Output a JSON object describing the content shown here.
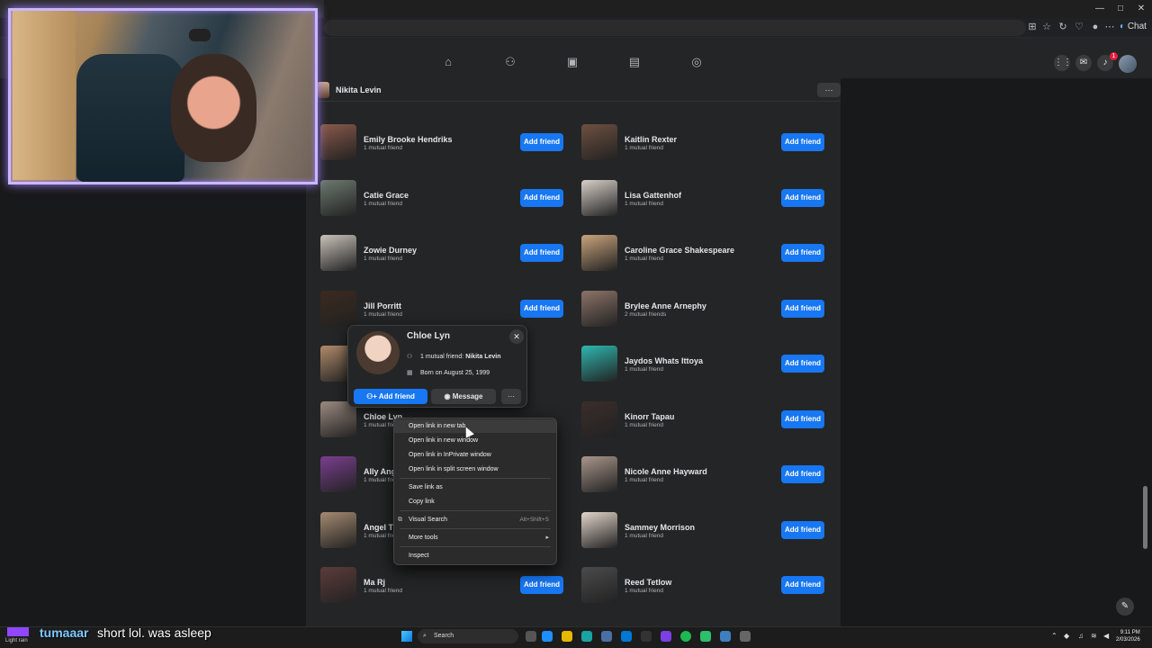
{
  "browser": {
    "copilot_label": "Chat",
    "window_controls": [
      "—",
      "□",
      "✕"
    ]
  },
  "profile": {
    "name": "Nikita Levin",
    "more_label": "···"
  },
  "friends_left": [
    {
      "name": "Emily Brooke Hendriks",
      "mutual": "1 mutual friend",
      "button": "Add friend",
      "photo": "#8a5a4a"
    },
    {
      "name": "Catie Grace",
      "mutual": "1 mutual friend",
      "button": "Add friend",
      "photo": "#6d7a70"
    },
    {
      "name": "Zowie Durney",
      "mutual": "1 mutual friend",
      "button": "Add friend",
      "photo": "#c9c2ba"
    },
    {
      "name": "Jill Porritt",
      "mutual": "1 mutual friend",
      "button": "Add friend",
      "photo": "#3b2a1f"
    },
    {
      "name": "",
      "mutual": "",
      "button": "",
      "photo": "#b08a6a"
    },
    {
      "name": "Chloe Lyn",
      "mutual": "1 mutual friend",
      "button": "",
      "photo": "#9c8a80"
    },
    {
      "name": "Ally Ang",
      "mutual": "1 mutual friend",
      "button": "",
      "photo": "#7a3f8f"
    },
    {
      "name": "Angel T",
      "mutual": "1 mutual friend",
      "button": "",
      "photo": "#a58a72"
    },
    {
      "name": "Ma Rj",
      "mutual": "1 mutual friend",
      "button": "Add friend",
      "photo": "#5c3c3a"
    }
  ],
  "friends_right": [
    {
      "name": "Kaitlin Rexter",
      "mutual": "1 mutual friend",
      "button": "Add friend",
      "photo": "#6e5040"
    },
    {
      "name": "Lisa Gattenhof",
      "mutual": "1 mutual friend",
      "button": "Add friend",
      "photo": "#d8cfc8"
    },
    {
      "name": "Caroline Grace Shakespeare",
      "mutual": "1 mutual friend",
      "button": "Add friend",
      "photo": "#c9a47c"
    },
    {
      "name": "Brylee Anne Arnephy",
      "mutual": "2 mutual friends",
      "button": "Add friend",
      "photo": "#8c7468"
    },
    {
      "name": "Jaydos Whats Ittoya",
      "mutual": "1 mutual friend",
      "button": "Add friend",
      "photo": "#2fb7b0"
    },
    {
      "name": "Kinorr Tapau",
      "mutual": "1 mutual friend",
      "button": "Add friend",
      "photo": "#3a2e2a"
    },
    {
      "name": "Nicole Anne Hayward",
      "mutual": "1 mutual friend",
      "button": "Add friend",
      "photo": "#a9968b"
    },
    {
      "name": "Sammey Morrison",
      "mutual": "1 mutual friend",
      "button": "Add friend",
      "photo": "#e3d6cb"
    },
    {
      "name": "Reed Tetlow",
      "mutual": "1 mutual friend",
      "button": "Add friend",
      "photo": "#4b4b4b"
    }
  ],
  "hovercard": {
    "name": "Chloe Lyn",
    "mutual_prefix": "1 mutual friend: ",
    "mutual_name": "Nikita Levin",
    "born": "Born on August 25, 1999",
    "add_label": "Add friend",
    "message_label": "Message",
    "more_label": "···",
    "close_label": "✕"
  },
  "context_menu": {
    "items": [
      {
        "label": "Open link in new tab"
      },
      {
        "label": "Open link in new window"
      },
      {
        "label": "Open link in InPrivate window"
      },
      {
        "label": "Open link in split screen window"
      },
      {
        "label": "Save link as"
      },
      {
        "label": "Copy link"
      },
      {
        "label": "Visual Search",
        "shortcut": "Alt+Shift+S"
      },
      {
        "label": "More tools"
      },
      {
        "label": "Inspect"
      }
    ]
  },
  "stream_chat": {
    "username": "tumaaar",
    "message": "short lol. was asleep"
  },
  "taskbar": {
    "search_label": "Search",
    "weather": "Light rain",
    "time": "9:11 PM",
    "date": "2/03/2026"
  },
  "icons": {
    "home": "home-icon",
    "friends": "friends-icon",
    "video": "video-icon",
    "marketplace": "marketplace-icon",
    "gaming": "gaming-icon",
    "menu": "grid-menu-icon",
    "messenger": "messenger-icon",
    "notifications": "bell-icon",
    "notif_count": "1"
  },
  "colors": {
    "accent": "#1877f2",
    "panel": "#242526",
    "background": "#18191a",
    "webcam_border": "#c8b8ff"
  }
}
